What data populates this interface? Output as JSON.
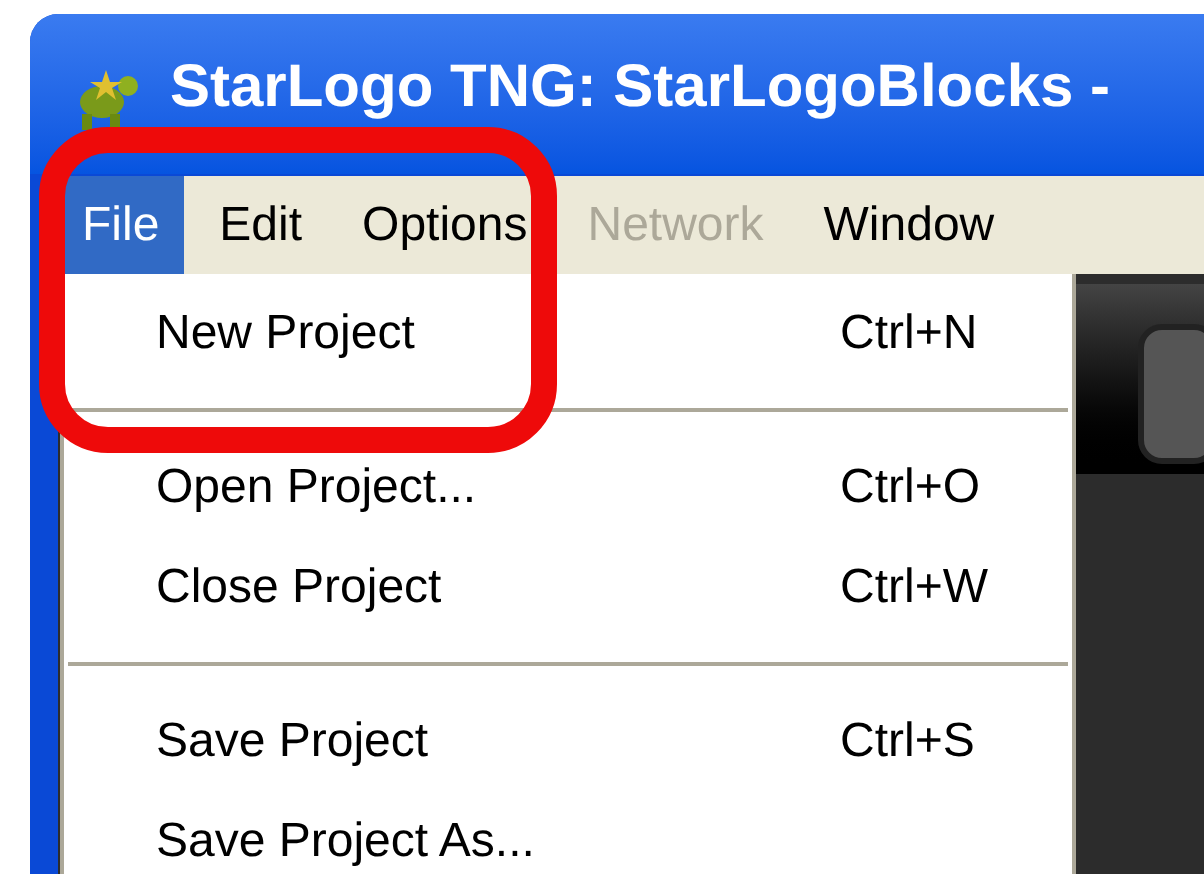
{
  "window": {
    "title": "StarLogo TNG: StarLogoBlocks -"
  },
  "menubar": [
    {
      "label": "File",
      "selected": true,
      "disabled": false
    },
    {
      "label": "Edit",
      "selected": false,
      "disabled": false
    },
    {
      "label": "Options",
      "selected": false,
      "disabled": false
    },
    {
      "label": "Network",
      "selected": false,
      "disabled": true
    },
    {
      "label": "Window",
      "selected": false,
      "disabled": false
    }
  ],
  "file_menu": [
    {
      "kind": "item",
      "label": "New Project",
      "shortcut": "Ctrl+N"
    },
    {
      "kind": "separator"
    },
    {
      "kind": "item",
      "label": "Open Project...",
      "shortcut": "Ctrl+O"
    },
    {
      "kind": "item",
      "label": "Close Project",
      "shortcut": "Ctrl+W"
    },
    {
      "kind": "separator"
    },
    {
      "kind": "item",
      "label": "Save Project",
      "shortcut": "Ctrl+S"
    },
    {
      "kind": "item",
      "label": "Save Project As..."
    }
  ]
}
